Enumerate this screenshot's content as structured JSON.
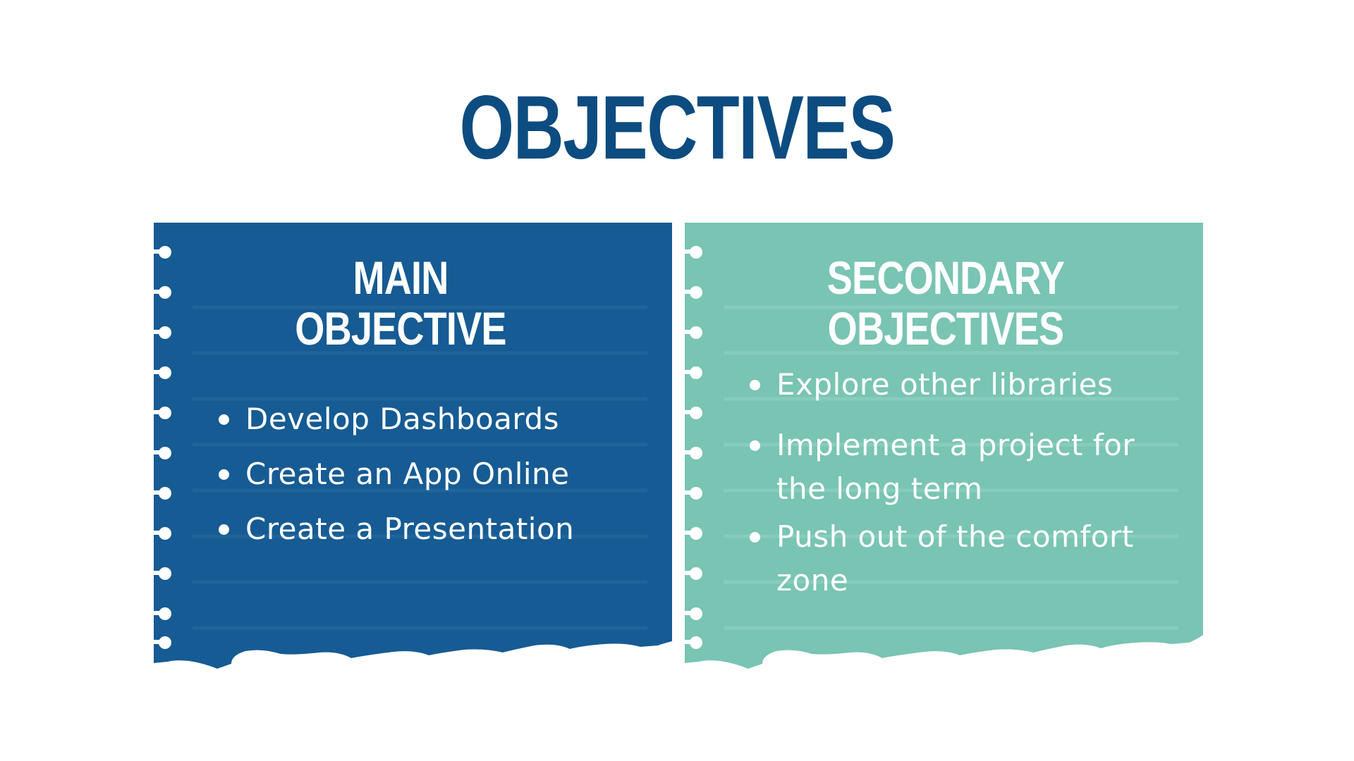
{
  "slide": {
    "title": "OBJECTIVES"
  },
  "colors": {
    "title": "#0c4c80",
    "main_card": "#165b93",
    "main_card_rule": "#1f659c",
    "secondary_card": "#79c4b3",
    "secondary_card_rule": "#87ccbd",
    "card_text": "#ffffff",
    "background": "#ffffff"
  },
  "main_card": {
    "heading_line1": "MAIN",
    "heading_line2": "OBJECTIVE",
    "bullets": [
      "Develop Dashboards",
      "Create an App Online",
      "Create a Presentation"
    ]
  },
  "secondary_card": {
    "heading_line1": "SECONDARY",
    "heading_line2": "OBJECTIVES",
    "bullets": [
      "Explore other libraries",
      "Implement a project for the long term",
      "Push out of the comfort zone"
    ]
  },
  "decor": {
    "binding_icon": "spiral-binding-hole-icon",
    "torn_edge": "torn-paper-edge"
  }
}
